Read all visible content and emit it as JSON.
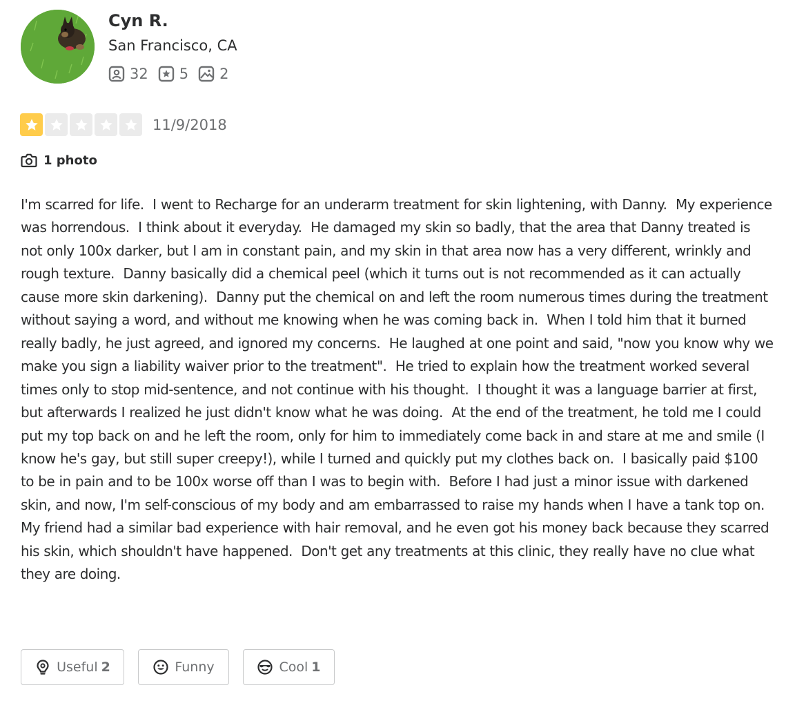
{
  "user": {
    "name": "Cyn R.",
    "location": "San Francisco, CA",
    "stats": {
      "friends": "32",
      "reviews": "5",
      "photos": "2"
    },
    "avatar_icon": "dog-on-grass-photo"
  },
  "review": {
    "rating": 1,
    "rating_max": 5,
    "date": "11/9/2018",
    "photo_count_label": "1 photo",
    "text": "I'm scarred for life.  I went to Recharge for an underarm treatment for skin lightening, with Danny.  My experience was horrendous.  I think about it everyday.  He damaged my skin so badly, that the area that Danny treated is not only 100x darker, but I am in constant pain, and my skin in that area now has a very different, wrinkly and rough texture.  Danny basically did a chemical peel (which it turns out is not recommended as it can actually cause more skin darkening).  Danny put the chemical on and left the room numerous times during the treatment without saying a word, and without me knowing when he was coming back in.  When I told him that it burned really badly, he just agreed, and ignored my concerns.  He laughed at one point and said, \"now you know why we make you sign a liability waiver prior to the treatment\".  He tried to explain how the treatment worked several times only to stop mid-sentence, and not continue with his thought.  I thought it was a language barrier at first, but afterwards I realized he just didn't know what he was doing.  At the end of the treatment, he told me I could put my top back on and he left the room, only for him to immediately come back in and stare at me and smile (I know he's gay, but still super creepy!), while I turned and quickly put my clothes back on.  I basically paid $100 to be in pain and to be 100x worse off than I was to begin with.  Before I had just a minor issue with darkened skin, and now, I'm self-conscious of my body and am embarrassed to raise my hands when I have a tank top on.  My friend had a similar bad experience with hair removal, and he even got his money back because they scarred his skin, which shouldn't have happened.  Don't get any treatments at this clinic, they really have no clue what they are doing."
  },
  "reactions": {
    "useful": {
      "label": "Useful",
      "count": "2",
      "icon": "lightbulb-icon"
    },
    "funny": {
      "label": "Funny",
      "count": "",
      "icon": "smile-face-icon"
    },
    "cool": {
      "label": "Cool",
      "count": "1",
      "icon": "sunglasses-face-icon"
    }
  },
  "colors": {
    "star_filled": "#ffcc4b",
    "star_empty": "#ebebeb",
    "text": "#2d2e2f",
    "muted": "#6e7072",
    "border": "#c8c9ca"
  }
}
